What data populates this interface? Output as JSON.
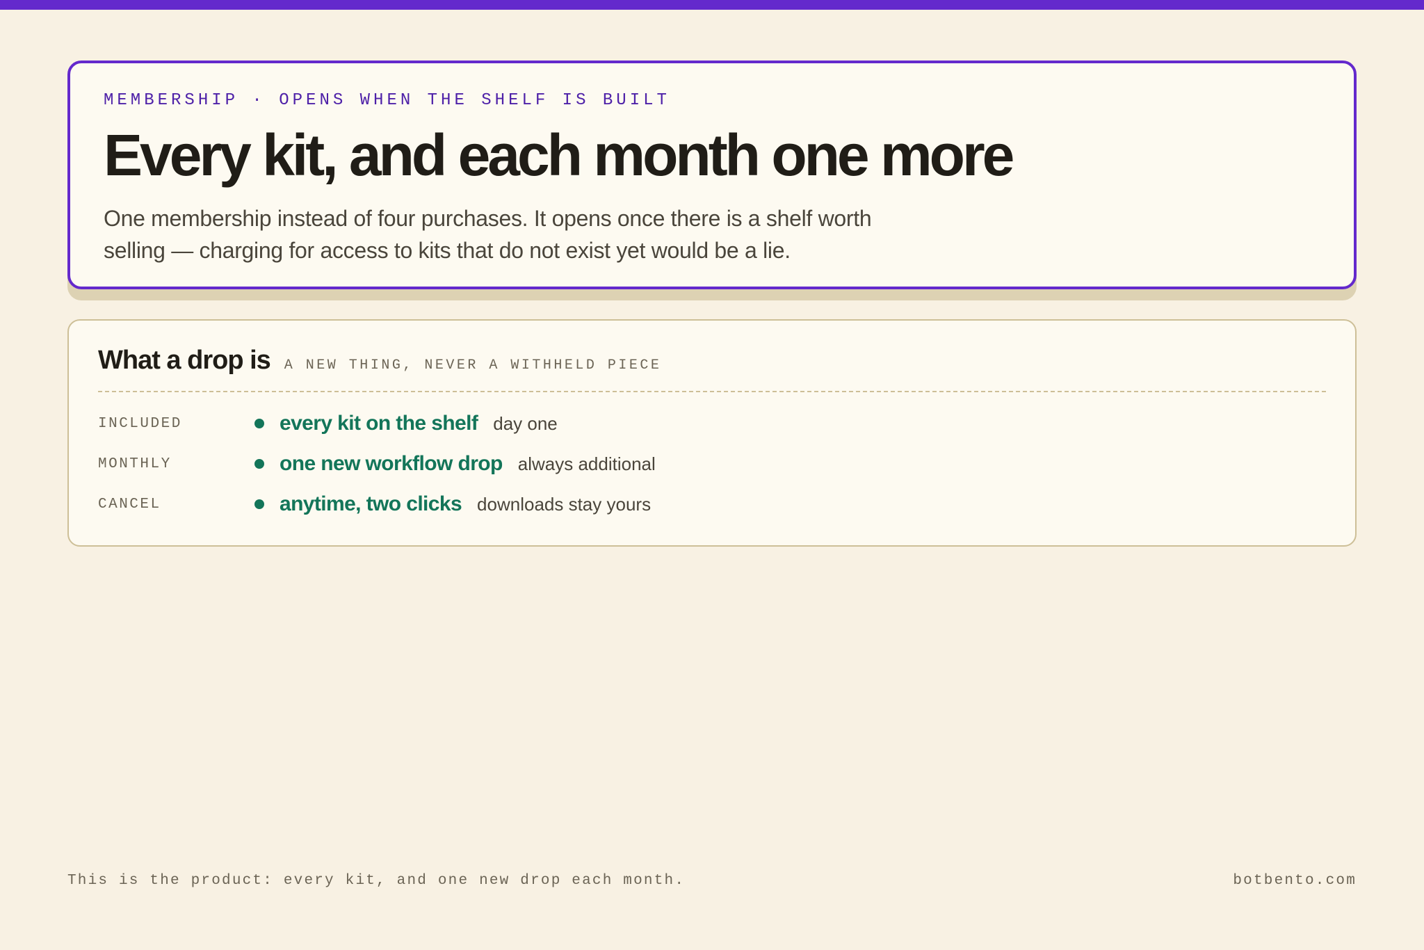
{
  "colors": {
    "accent": "#6429cc",
    "background": "#f8f1e3",
    "card": "#fdfaf1",
    "green": "#137559",
    "border": "#cdbf97"
  },
  "hero": {
    "eyebrow": "MEMBERSHIP · OPENS WHEN THE SHELF IS BUILT",
    "headline": "Every kit, and each month one more",
    "lede": "One membership instead of four purchases. It opens once there is a shelf worth selling — charging for access to kits that do not exist yet would be a lie."
  },
  "drop": {
    "title": "What a drop is",
    "subtitle": "A NEW THING, NEVER A WITHHELD PIECE",
    "rows": [
      {
        "label": "INCLUDED",
        "main": "every kit on the shelf",
        "note": "day one"
      },
      {
        "label": "MONTHLY",
        "main": "one new workflow drop",
        "note": "always additional"
      },
      {
        "label": "CANCEL",
        "main": "anytime, two clicks",
        "note": "downloads stay yours"
      }
    ]
  },
  "footer": {
    "statement": "This is the product: every kit, and one new drop each month.",
    "domain": "botbento.com"
  }
}
